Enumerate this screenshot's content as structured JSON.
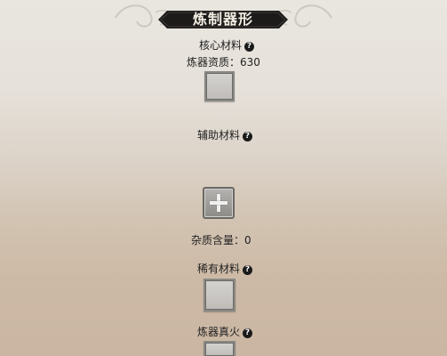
{
  "header": {
    "title": "炼制器形"
  },
  "core_material": {
    "label": "核心材料",
    "quality_text": "炼器资质：630"
  },
  "aux_material": {
    "label": "辅助材料"
  },
  "impurity": {
    "text": "杂质含量：0"
  },
  "rare_material": {
    "label": "稀有材料"
  },
  "true_fire": {
    "label": "炼器真火"
  },
  "icons": {
    "help": "?"
  }
}
